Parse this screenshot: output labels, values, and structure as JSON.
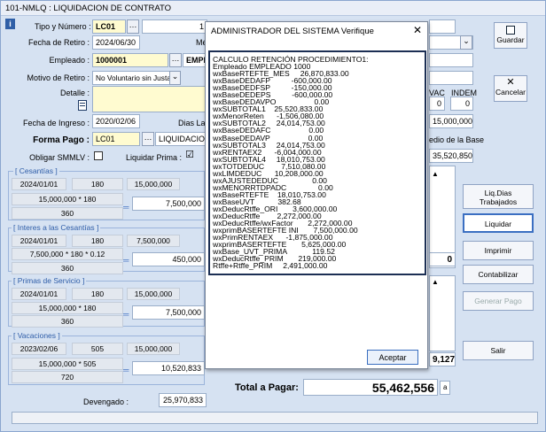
{
  "window": {
    "title": "101-NMLQ : LIQUIDACION DE CONTRATO",
    "info_glyph": "i"
  },
  "header": {
    "tipo_label": "Tipo y Número :",
    "tipo_value": "LC01",
    "numero_value": "1",
    "fecha_retiro_label": "Fecha de Retiro :",
    "fecha_retiro_value": "2024/06/30",
    "fecha_retiro_suffix": "Mé",
    "empleado_label": "Empleado :",
    "empleado_code": "1000001",
    "empleado_name": "EMPLI",
    "motivo_label": "Motivo de Retiro :",
    "motivo_value": "No Voluntario sin Justa",
    "detalle_label": "Detalle :",
    "fecha_ingreso_label": "Fecha de Ingreso :",
    "fecha_ingreso_value": "2020/02/06",
    "dias_lab_label": "Dias Lab",
    "forma_pago_label": "Forma Pago :",
    "forma_pago_code": "LC01",
    "forma_pago_name": "LIQUIDACION",
    "obligar_label": "Obligar SMMLV :",
    "liquidar_prima_label": "Liquidar Prima :",
    "liquidar_prima_check": "☑"
  },
  "right_header": {
    "vac_label": "VAC",
    "indem_label": "INDEM",
    "vac_value": "0",
    "indem_value": "0",
    "salary_value": "15,000,000",
    "medio_label": "edio de la Base",
    "medio_value": "35,520,850"
  },
  "groups": {
    "cesantias": {
      "title": "[ Cesantías ]",
      "date": "2024/01/01",
      "days": "180",
      "base": "15,000,000",
      "formula": "15,000,000 * 180",
      "divisor": "360",
      "result": "7,500,000"
    },
    "intereses": {
      "title": "[ Interes a las Cesantías ]",
      "date": "2024/01/01",
      "days": "180",
      "base": "7,500,000",
      "formula": "7,500,000 * 180 * 0.12",
      "divisor": "360",
      "result": "450,000"
    },
    "primas": {
      "title": "[ Primas de Servicio ]",
      "date": "2024/01/01",
      "days": "180",
      "base": "15,000,000",
      "formula": "15,000,000 * 180",
      "divisor": "360",
      "result": "7,500,000"
    },
    "vacaciones": {
      "title": "[ Vacaciones ]",
      "date": "2023/02/06",
      "days": "505",
      "base": "15,000,000",
      "formula": "15,000,000 * 505",
      "divisor": "720",
      "result": "10,520,833"
    }
  },
  "right_values": {
    "zero_value": "0",
    "partial_value": "9,127"
  },
  "devengado": {
    "label": "Devengado :",
    "value": "25,970,833"
  },
  "total": {
    "label": "Total a Pagar:",
    "value": "55,462,556",
    "suffix": "a"
  },
  "buttons": {
    "guardar": "Guardar",
    "cancelar": "Cancelar",
    "liq_dias": "Liq.Dias Trabajados",
    "liquidar": "Liquidar",
    "imprimir": "Imprimir",
    "contabilizar": "Contabilizar",
    "generar_pago": "Generar Pago",
    "salir": "Salir"
  },
  "dialog": {
    "title": "ADMINISTRADOR DEL SISTEMA Verifique",
    "close": "✕",
    "lines": [
      "CALCULO RETENCIÓN PROCEDIMIENTO1:",
      "Empleado EMPLEADO 1000",
      "wxBaseRTEFTE_MES     26,870,833.00",
      "wxBaseDEDAFP          -600,000.00",
      "wxBaseDEDFSP          -150,000.00",
      "wxBaseDEDEPS          -600,000.00",
      "wxBaseDEDAVPO                  0.00",
      "wxSUBTOTAL1    25,520,833.00",
      "wxMenorReten      -1,506,080.00",
      "wxSUBTOTAL2     24,014,753.00",
      "wxBaseDEDAFC                  0.00",
      "wxBaseDEDAVP                  0.00",
      "wxSUBTOTAL3     24,014,753.00",
      "wxRENTAEX2      -6,004,000.00",
      "wxSUBTOTAL4     18,010,753.00",
      "wxTOTDEDUC        7,510,080.00",
      "wxLIMDEDUC      10,208,000.00",
      "wxAJUSTEDEDUC                0.00",
      "wxMENORRTDPADC               0.00",
      "wxBaseRTEFTE    18,010,753.00",
      "wxBaseUVT           382.68",
      "wxDeducRtffe_ORI       3,600,000.00",
      "wxDeducRtffe        2,272,000.00",
      "wxDeducRtffe/wxFactor       2,272,000.00",
      "wxprimBASERTEFTE INI       7,500,000.00",
      "wxPrimRENTAEX      -1,875,000.00",
      "wxprimBASERTEFTE       5,625,000.00",
      "wxBase_UVT_PRIMA            119.52",
      "wxDeducRtffe_PRIM       219,000.00",
      "Rtffe+Rtffe_PRIM     2,491,000.00"
    ],
    "accept_label": "Aceptar"
  }
}
